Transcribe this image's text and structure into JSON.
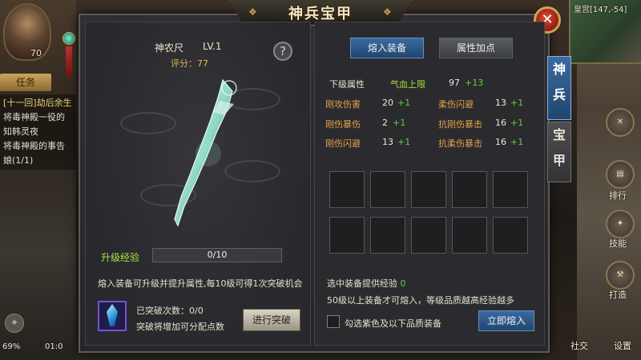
{
  "hud": {
    "player_level": "70",
    "map_coords": "皇宫[147,-54]",
    "quest_tab": "任务",
    "quests": [
      {
        "text": "[十一回]劫后余生",
        "color": "#e8d37a"
      },
      {
        "text": "将毒神殿一役的",
        "color": "#e0dbcc"
      },
      {
        "text": "知韩灵夜",
        "color": "#e0dbcc"
      },
      {
        "text": "将毒神殿的事告",
        "color": "#e0dbcc"
      },
      {
        "text": "娘(1/1)",
        "color": "#e0dbcc"
      }
    ],
    "battery": "69%",
    "time": "01:0",
    "right_buttons": [
      "排行",
      "技能",
      "打造",
      "任务"
    ],
    "right_labels": [
      "排行",
      "技能",
      "打造",
      "社交",
      "设置"
    ]
  },
  "panel": {
    "title": "神兵宝甲",
    "close_label": "✕",
    "side_tabs": [
      {
        "label": "神兵",
        "active": true
      },
      {
        "label": "宝甲",
        "active": false
      }
    ]
  },
  "item": {
    "name": "神农尺",
    "level": "LV.1",
    "score_label": "评分：77",
    "help_label": "?",
    "exp_label": "升级经验",
    "exp_current": 0,
    "exp_max": 10,
    "exp_text": "0/10",
    "hint": "熔入装备可升级并提升属性,每10级可得1次突破机会",
    "break_count_label": "已突破次数：0/0",
    "break_note": "突破将增加可分配点数",
    "break_button": "进行突破"
  },
  "right": {
    "tabs": [
      {
        "label": "熔入装备",
        "active": true
      },
      {
        "label": "属性加点",
        "active": false
      }
    ],
    "next_level_label": "下级属性",
    "hp_label": "气血上限",
    "hp_value": "97",
    "hp_plus": "+13",
    "attributes": [
      {
        "name": "刚攻伤害",
        "value": "20",
        "plus": "+1"
      },
      {
        "name": "柔伤闪避",
        "value": "13",
        "plus": "+1"
      },
      {
        "name": "刚伤暴伤",
        "value": "2",
        "plus": "+1"
      },
      {
        "name": "抗刚伤暴击",
        "value": "16",
        "plus": "+1"
      },
      {
        "name": "刚伤闪避",
        "value": "13",
        "plus": "+1"
      },
      {
        "name": "抗柔伤暴击",
        "value": "16",
        "plus": "+1"
      }
    ],
    "slot_count": 10,
    "exp_provide_label": "选中装备提供经验",
    "exp_provide_value": "0",
    "rule_text": "50级以上装备才可熔入，等级品质越高经验越多",
    "checkbox_label": "勾选紫色及以下品质装备",
    "merge_button": "立即熔入"
  },
  "colors": {
    "accent_blue": "#2f5a8c",
    "gold": "#c8a552",
    "green": "#5fd03a",
    "orange": "#e8a04a"
  }
}
